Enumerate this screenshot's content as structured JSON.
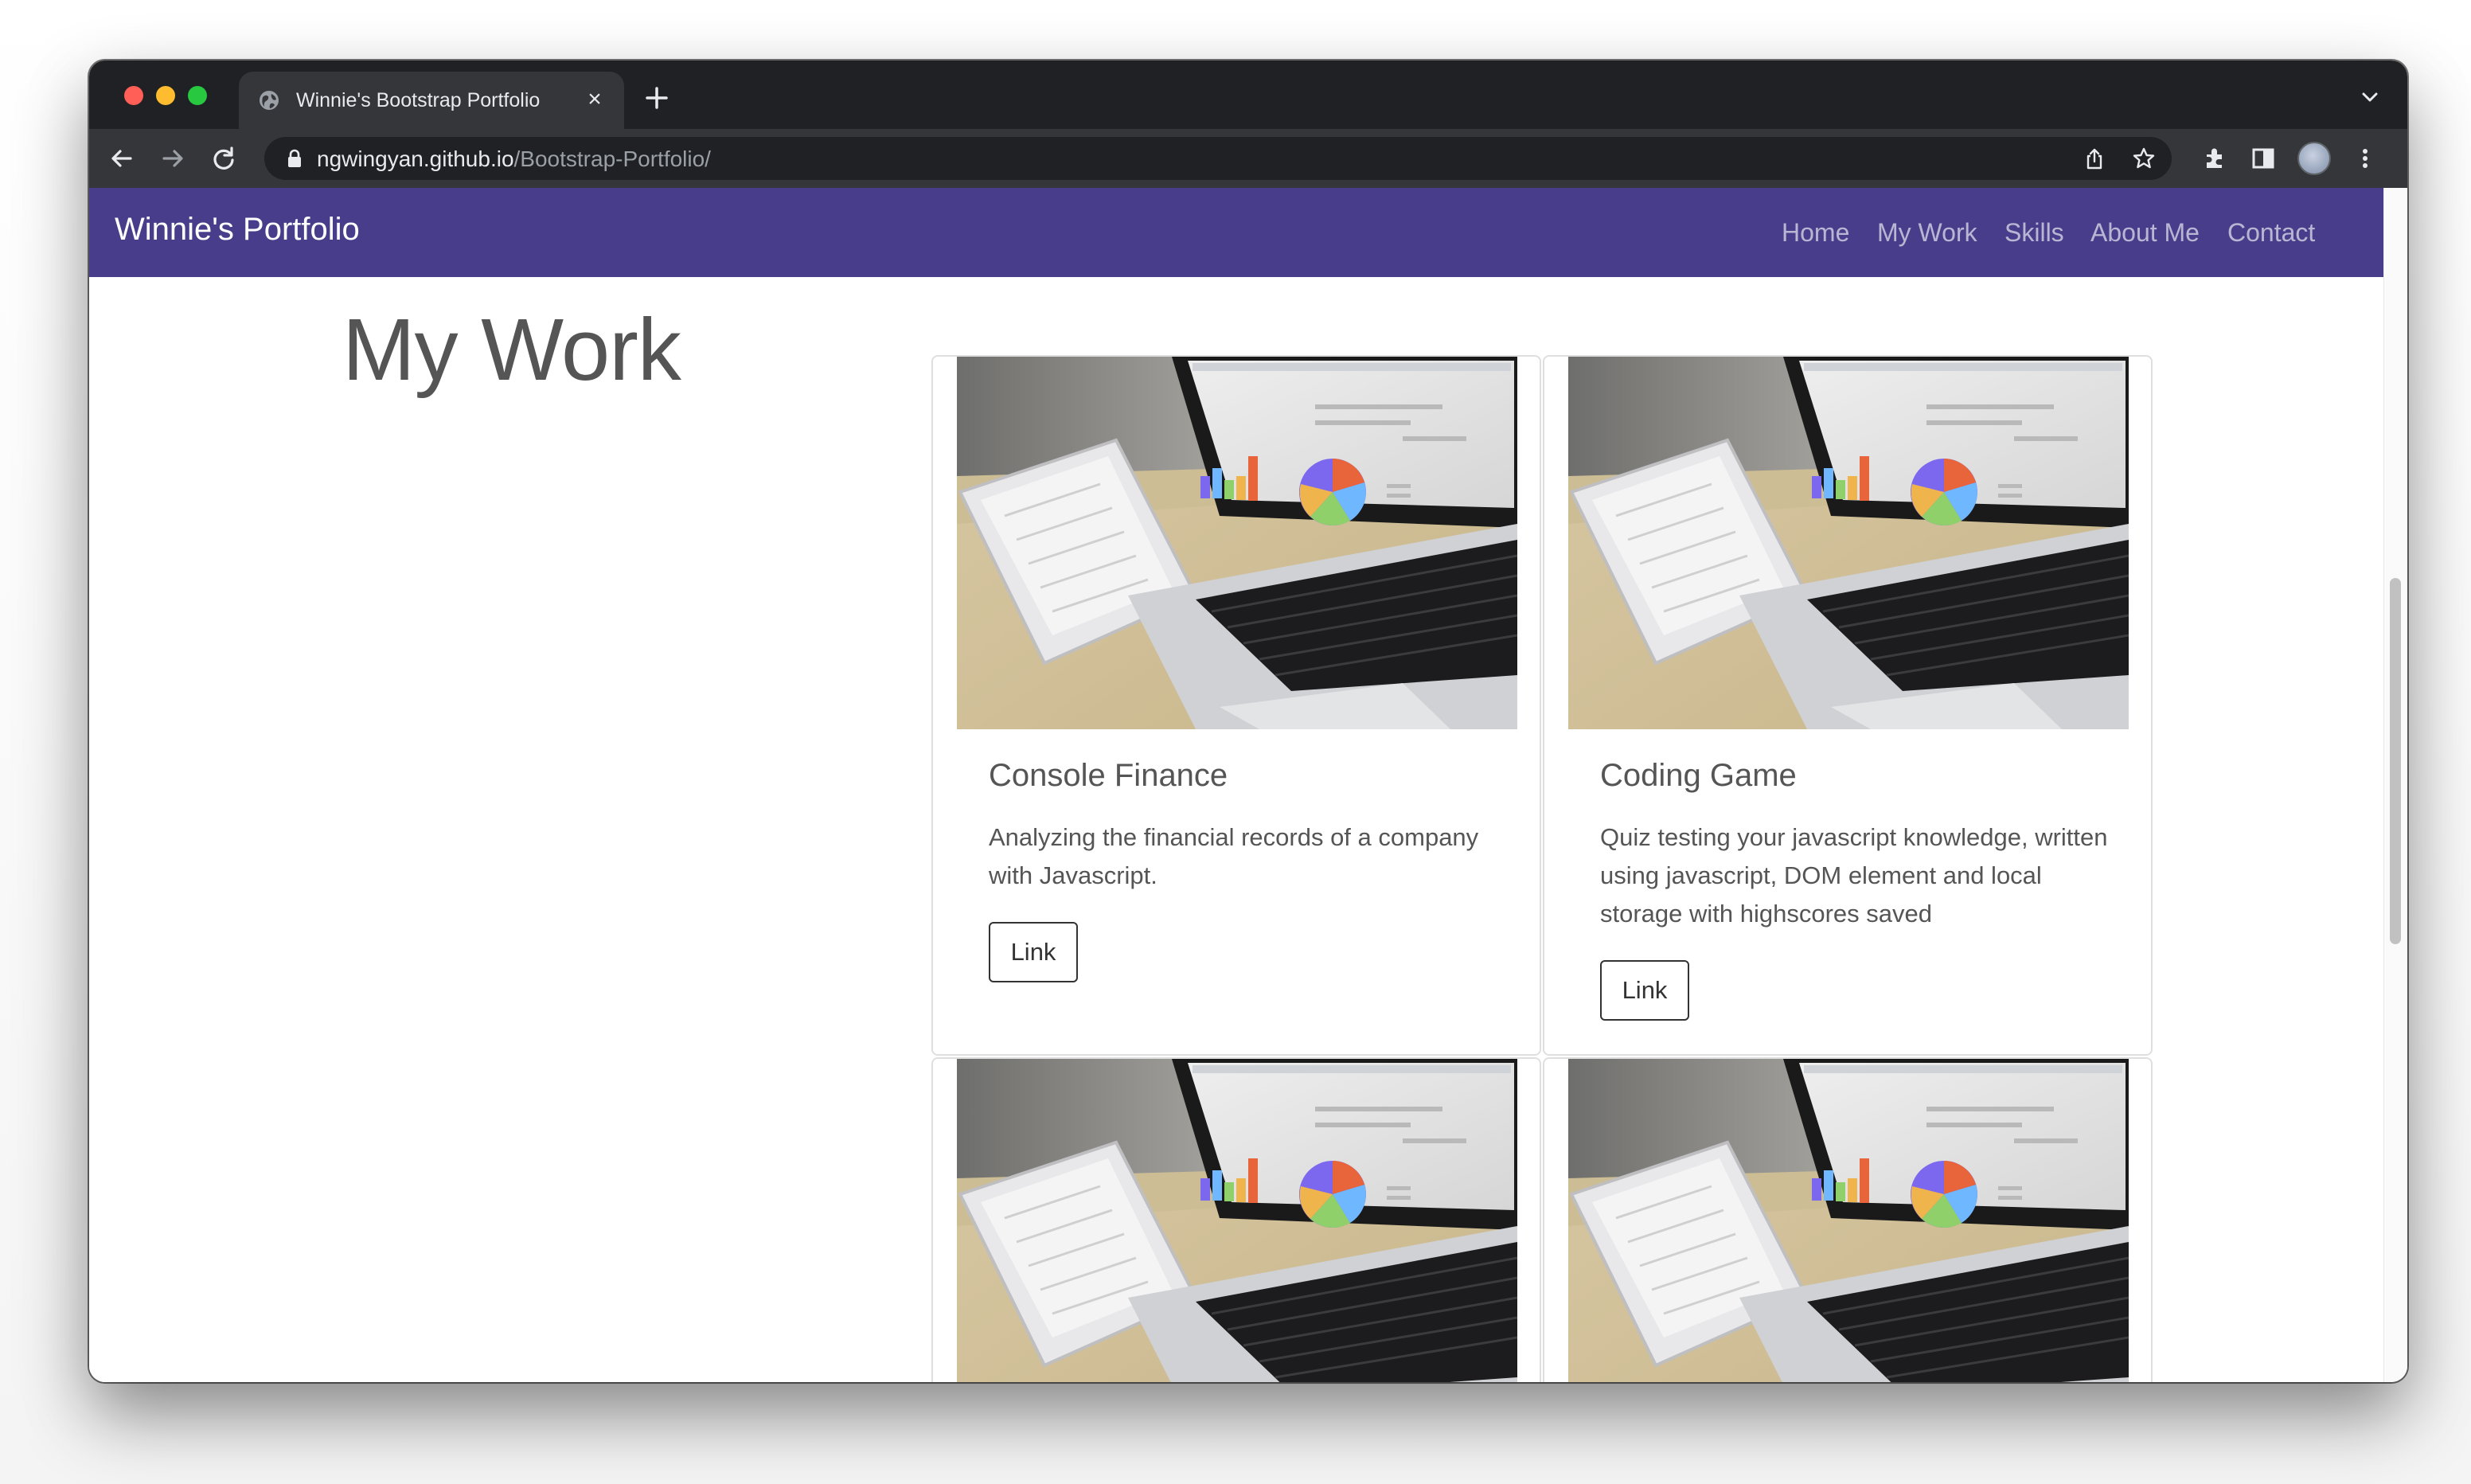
{
  "browser": {
    "tab_title": "Winnie's Bootstrap Portfolio",
    "tab_close": "×",
    "url_host": "ngwingyan.github.io",
    "url_path": "/Bootstrap-Portfolio/",
    "icons": [
      "globe-icon",
      "new-tab-icon",
      "tab-search-icon",
      "back-icon",
      "forward-icon",
      "reload-icon",
      "lock-icon",
      "share-icon",
      "bookmark-star-icon",
      "extensions-icon",
      "side-panel-icon",
      "profile-avatar",
      "more-menu-icon"
    ]
  },
  "navbar": {
    "brand": "Winnie's Portfolio",
    "background": "#483d8b",
    "links": [
      "Home",
      "My Work",
      "Skills",
      "About Me",
      "Contact"
    ]
  },
  "section": {
    "title": "My Work"
  },
  "cards": [
    {
      "title": "Console Finance",
      "text": "Analyzing the financial records of a company with Javascript.",
      "button": "Link",
      "image": "laptop-and-tablet-charts-photo"
    },
    {
      "title": "Coding Game",
      "text": "Quiz testing your javascript knowledge, written using javascript, DOM element and local storage with highscores saved",
      "button": "Link",
      "image": "laptop-and-tablet-charts-photo"
    },
    {
      "image": "laptop-and-tablet-charts-photo"
    },
    {
      "image": "laptop-and-tablet-charts-photo"
    }
  ]
}
